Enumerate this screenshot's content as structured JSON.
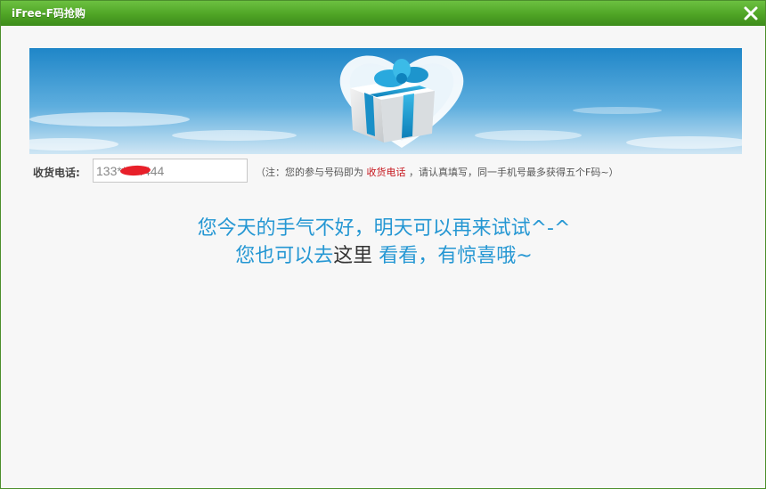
{
  "window": {
    "title": "iFree-F码抢购"
  },
  "form": {
    "phone_label": "收货电话:",
    "phone_value": "133****4444",
    "hint_prefix": "（注：您的参与号码即为",
    "hint_highlight": "收货电话",
    "hint_suffix": "，请认真填写，同一手机号最多获得五个F码~）"
  },
  "message": {
    "line1": "您今天的手气不好，明天可以再来试试^-^",
    "line2_before": "您也可以去",
    "line2_link": "这里",
    "line2_after": " 看看，有惊喜哦~"
  },
  "colors": {
    "title_bar": "#4fa425",
    "message_text": "#2597d3",
    "hint_highlight": "#c6161d"
  }
}
